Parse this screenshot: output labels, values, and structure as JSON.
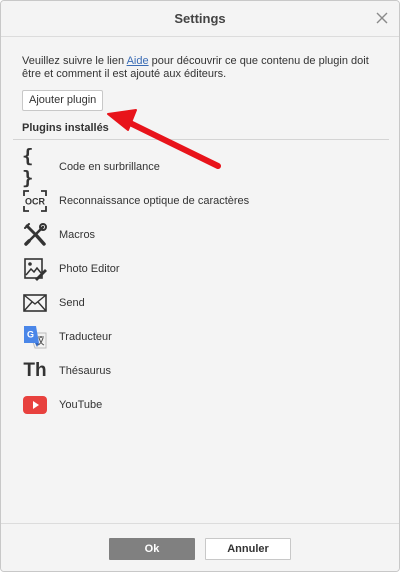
{
  "dialog": {
    "title": "Settings",
    "intro_before": "Veuillez suivre le lien ",
    "intro_link": "Aide",
    "intro_after": " pour découvrir ce que contenu de plugin doit être et comment il est ajouté aux éditeurs.",
    "add_button": "Ajouter plugin",
    "installed_title": "Plugins installés"
  },
  "plugins": [
    {
      "label": "Code en surbrillance",
      "icon": "braces-icon"
    },
    {
      "label": "Reconnaissance optique de caractères",
      "icon": "ocr-icon"
    },
    {
      "label": "Macros",
      "icon": "tools-icon"
    },
    {
      "label": "Photo Editor",
      "icon": "photo-editor-icon"
    },
    {
      "label": "Send",
      "icon": "envelope-icon"
    },
    {
      "label": "Traducteur",
      "icon": "translate-icon"
    },
    {
      "label": "Thésaurus",
      "icon": "thesaurus-icon"
    },
    {
      "label": "YouTube",
      "icon": "youtube-icon"
    }
  ],
  "footer": {
    "ok": "Ok",
    "cancel": "Annuler"
  },
  "icon_text": {
    "braces": "{ }",
    "ocr": "OCR",
    "thesaurus": "Th",
    "translate": "G"
  },
  "colors": {
    "link": "#3a6cb5",
    "ok_button": "#808080",
    "arrow": "#e8141b",
    "youtube": "#e8413e",
    "translate": "#4a86e8"
  }
}
